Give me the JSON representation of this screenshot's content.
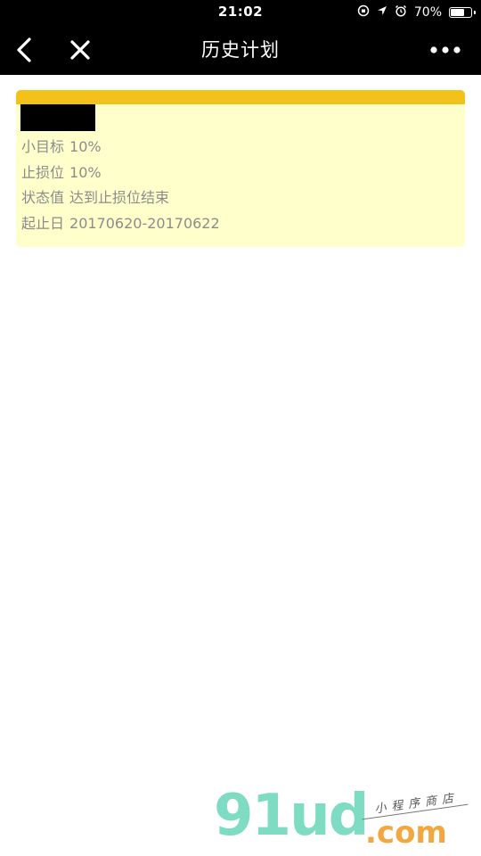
{
  "status_bar": {
    "time": "21:02",
    "battery_percent": "70%",
    "battery_level": 0.7
  },
  "nav": {
    "title": "历史计划",
    "back_icon": "chevron-left-icon",
    "close_icon": "close-icon",
    "more_icon": "more-dots-icon"
  },
  "plan": {
    "target_label": "小目标",
    "target_value": "10%",
    "stoploss_label": "止损位",
    "stoploss_value": "10%",
    "status_label": "状态值",
    "status_value": "达到止损位结束",
    "dates_label": "起止日",
    "dates_value": "20170620-20170622"
  },
  "watermark": {
    "brand": "91ud",
    "domain": ".com",
    "tagline": "小程序商店"
  },
  "colors": {
    "nav_bg": "#000000",
    "card_bg": "#ffffcc",
    "card_accent": "#f2c21b",
    "text_gray": "#8c8c8c"
  }
}
